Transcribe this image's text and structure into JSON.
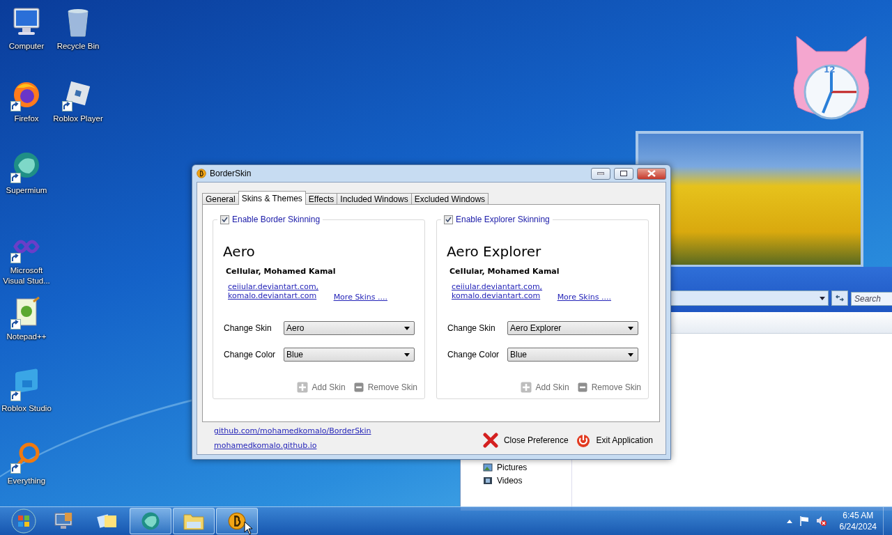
{
  "desktop_icons": [
    {
      "label": "Computer",
      "kind": "computer"
    },
    {
      "label": "Recycle Bin",
      "kind": "recycle"
    },
    {
      "label": "Firefox",
      "kind": "firefox",
      "shortcut": true
    },
    {
      "label": "Roblox Player",
      "kind": "roblox",
      "shortcut": true
    },
    {
      "label": "Supermium",
      "kind": "supermium",
      "shortcut": true
    },
    {
      "label": "Microsoft Visual Stud...",
      "kind": "vs",
      "shortcut": true
    },
    {
      "label": "Notepad++",
      "kind": "notepad",
      "shortcut": true
    },
    {
      "label": "Roblox Studio",
      "kind": "studio",
      "shortcut": true
    },
    {
      "label": "Everything",
      "kind": "everything",
      "shortcut": true
    }
  ],
  "clock_gadget": {
    "numeral": "12"
  },
  "explorer": {
    "search": {
      "placeholder": "Search"
    },
    "nav_items": [
      {
        "label": "Pictures",
        "kind": "pictures"
      },
      {
        "label": "Videos",
        "kind": "videos"
      }
    ]
  },
  "dialog": {
    "title": "BorderSkin",
    "tabs": [
      {
        "label": "General",
        "selected": false
      },
      {
        "label": "Skins & Themes",
        "selected": true
      },
      {
        "label": "Effects",
        "selected": false
      },
      {
        "label": "Included Windows",
        "selected": false
      },
      {
        "label": "Excluded Windows",
        "selected": false
      }
    ],
    "panels": [
      {
        "checkbox_label": "Enable Border Skinning",
        "checked": true,
        "skin_name": "Aero",
        "author": "CeIIular, Mohamed Kamal",
        "links": [
          "ceiiular.deviantart.com,",
          "komalo.deviantart.com"
        ],
        "more_link": "More Skins ....",
        "fields": [
          {
            "label": "Change Skin",
            "value": "Aero"
          },
          {
            "label": "Change Color",
            "value": "Blue"
          }
        ],
        "buttons": [
          {
            "label": "Add Skin",
            "kind": "add",
            "disabled": true
          },
          {
            "label": "Remove Skin",
            "kind": "remove",
            "disabled": true
          }
        ]
      },
      {
        "checkbox_label": "Enable Explorer Skinning",
        "checked": true,
        "skin_name": "Aero Explorer",
        "author": "CeIIular, Mohamed Kamal",
        "links": [
          "ceiiular.deviantart.com,",
          "komalo.deviantart.com"
        ],
        "more_link": "More Skins ....",
        "fields": [
          {
            "label": "Change Skin",
            "value": "Aero Explorer"
          },
          {
            "label": "Change Color",
            "value": "Blue"
          }
        ],
        "buttons": [
          {
            "label": "Add Skin",
            "kind": "add",
            "disabled": true
          },
          {
            "label": "Remove Skin",
            "kind": "remove",
            "disabled": true
          }
        ]
      }
    ],
    "footer_links": [
      "github.com/mohamedkomalo/BorderSkin",
      "mohamedkomalo.github.io"
    ],
    "actions": [
      {
        "label": "Close Preference",
        "kind": "close"
      },
      {
        "label": "Exit Application",
        "kind": "exit"
      }
    ]
  },
  "taskbar": {
    "items": [
      {
        "kind": "monitor",
        "running": false
      },
      {
        "kind": "notes",
        "running": false
      },
      {
        "kind": "supermium",
        "running": true
      },
      {
        "kind": "folder",
        "running": true
      },
      {
        "kind": "borderskin",
        "running": true
      }
    ],
    "clock": {
      "time": "6:45 AM",
      "date": "6/24/2024"
    }
  }
}
